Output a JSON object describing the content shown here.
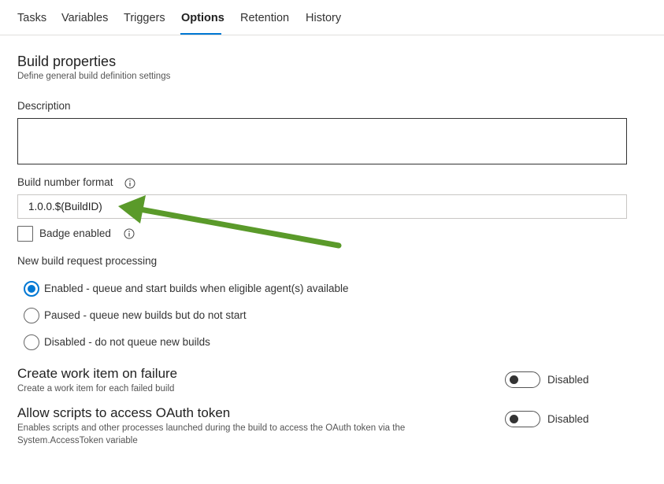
{
  "tabs": [
    {
      "label": "Tasks"
    },
    {
      "label": "Variables"
    },
    {
      "label": "Triggers"
    },
    {
      "label": "Options"
    },
    {
      "label": "Retention"
    },
    {
      "label": "History"
    }
  ],
  "active_tab": "Options",
  "build_properties": {
    "title": "Build properties",
    "subtitle": "Define general build definition settings"
  },
  "description": {
    "label": "Description",
    "value": ""
  },
  "build_number_format": {
    "label": "Build number format",
    "value": "1.0.0.$(BuildID)"
  },
  "badge": {
    "label": "Badge enabled",
    "checked": false
  },
  "new_build_request": {
    "label": "New build request processing",
    "options": [
      {
        "label": "Enabled - queue and start builds when eligible agent(s) available",
        "selected": true
      },
      {
        "label": "Paused - queue new builds but do not start",
        "selected": false
      },
      {
        "label": "Disabled - do not queue new builds",
        "selected": false
      }
    ]
  },
  "work_item": {
    "title": "Create work item on failure",
    "subtitle": "Create a work item for each failed build",
    "toggle_label": "Disabled"
  },
  "oauth": {
    "title": "Allow scripts to access OAuth token",
    "subtitle_line1": "Enables scripts and other processes launched during the build to access the OAuth token via the",
    "subtitle_line2": "System.AccessToken variable",
    "toggle_label": "Disabled"
  },
  "colors": {
    "accent": "#0078d4",
    "annotation_arrow": "#5a9a2a"
  },
  "icons": [
    "info-icon",
    "arrow-annotation"
  ]
}
